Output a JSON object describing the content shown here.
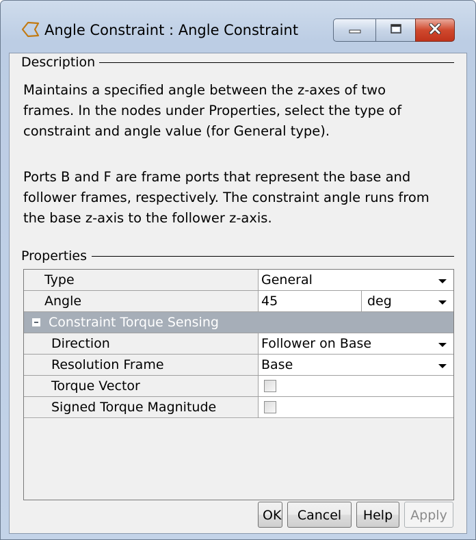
{
  "window": {
    "title": "Angle Constraint : Angle Constraint"
  },
  "description": {
    "group_label": "Description",
    "lines": [
      "Maintains a specified angle between the z-axes of two",
      "frames. In the nodes under Properties, select the type of",
      "constraint and angle value (for General type).",
      "",
      "Ports B and F are frame ports that represent the base and",
      "follower frames, respectively. The constraint angle runs from",
      "the base z-axis to the follower z-axis."
    ]
  },
  "properties": {
    "group_label": "Properties",
    "rows": [
      {
        "name": "Type",
        "value": "General"
      },
      {
        "name": "Angle",
        "value": "45",
        "unit": "deg"
      },
      {
        "section": "Constraint Torque Sensing"
      },
      {
        "name": "Direction",
        "value": "Follower on Base"
      },
      {
        "name": "Resolution Frame",
        "value": "Base"
      },
      {
        "name": "Torque Vector",
        "checked": false
      },
      {
        "name": "Signed Torque Magnitude",
        "checked": false
      }
    ]
  },
  "buttons": {
    "ok": "OK",
    "cancel": "Cancel",
    "help": "Help",
    "apply": "Apply"
  },
  "icons": {
    "title": "block-icon",
    "minimize": "minimize-icon",
    "maximize": "maximize-icon",
    "close": "close-icon"
  },
  "colors": {
    "section_header": "#a6aeb8",
    "close_button": "#c7341f"
  }
}
